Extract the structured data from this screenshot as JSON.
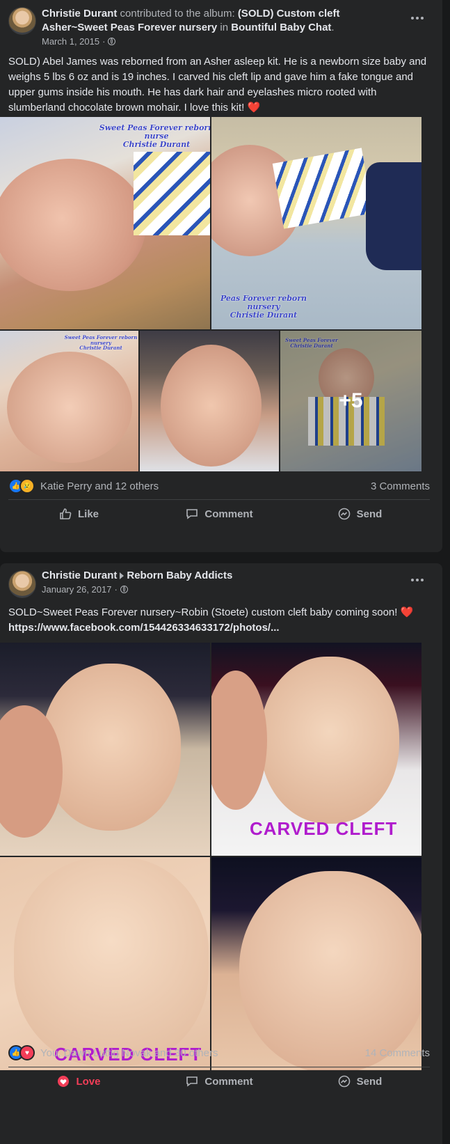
{
  "post1": {
    "author": "Christie Durant",
    "contrib_text": "contributed to the album:",
    "album_title": "(SOLD) Custom cleft Asher~Sweet Peas Forever nursery",
    "in_text": "in",
    "group": "Bountiful Baby Chat",
    "period": ".",
    "date": "March 1, 2015",
    "dot": "·",
    "text": "SOLD) Abel James was reborned from an Asher asleep kit. He is a newborn size baby and weighs 5 lbs 6 oz and is 19 inches. I carved his cleft lip and gave him a fake tongue and upper gums inside his mouth. He has dark hair and eyelashes micro rooted with slumberland chocolate brown mohair. I love this kit!",
    "heart_emoji": "❤️",
    "watermark1": "Sweet Peas Forever reborn nurse\nChristie Durant",
    "watermark2": "Peas Forever reborn nursery\nChristie Durant",
    "watermark3": "Sweet Peas Forever reborn nursery\nChristie Durant",
    "watermark5": "Sweet Peas Forever\nChristie Durant",
    "more_photos": "+5",
    "reactions_names": "Katie Perry and 12 others",
    "comments_count": "3 Comments",
    "actions": {
      "like": "Like",
      "comment": "Comment",
      "send": "Send"
    }
  },
  "post2": {
    "author": "Christie Durant",
    "group": "Reborn Baby Addicts",
    "date": "January 26, 2017",
    "dot": "·",
    "text": "SOLD~Sweet Peas Forever nursery~Robin (Stoete) custom cleft baby coming soon!",
    "heart_emoji": "❤️",
    "link": "https://www.facebook.com/154426334633172/photos/...",
    "caption_carved": "CARVED CLEFT",
    "reactions_names": "You, Dawn Luttig Novak and 30 others",
    "comments_count": "14 Comments",
    "actions": {
      "love": "Love",
      "comment": "Comment",
      "send": "Send"
    }
  },
  "colors": {
    "background": "#18191a",
    "card": "#242526",
    "text": "#e4e6eb",
    "muted": "#b0b3b8",
    "like_blue": "#1877f2",
    "love_red": "#f33e58",
    "watermark_blue": "#3e48c9",
    "caption_purple": "#b01ccd"
  }
}
